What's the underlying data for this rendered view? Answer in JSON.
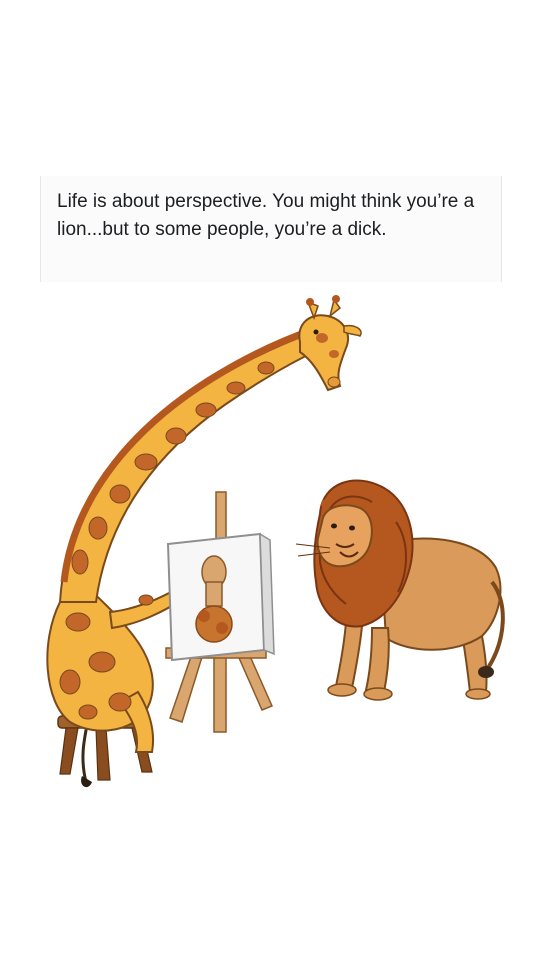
{
  "post": {
    "text": "Life is about perspective. You might think you’re a lion...but to some people, you’re a dick."
  },
  "illustration": {
    "subjects": [
      "giraffe",
      "easel",
      "canvas",
      "lion",
      "stool"
    ],
    "colors": {
      "giraffe_body": "#f3b442",
      "giraffe_spots": "#c2662a",
      "lion_body": "#d99a5a",
      "lion_mane": "#b5581f",
      "easel_wood": "#d9a670",
      "canvas": "#f7f7f7"
    }
  }
}
